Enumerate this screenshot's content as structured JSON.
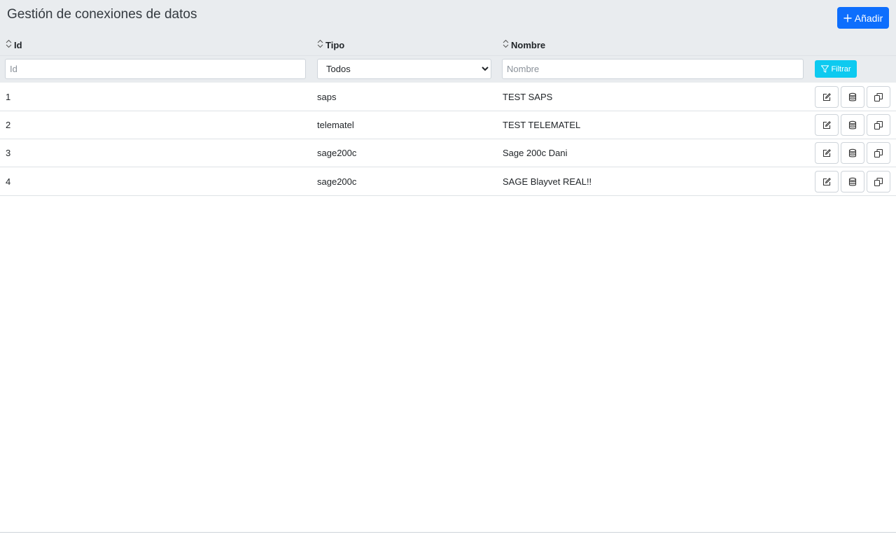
{
  "header": {
    "title": "Gestión de conexiones de datos",
    "add_label": "Añadir"
  },
  "columns": {
    "id": "Id",
    "tipo": "Tipo",
    "nombre": "Nombre"
  },
  "filters": {
    "id_placeholder": "Id",
    "tipo_selected": "Todos",
    "nombre_placeholder": "Nombre",
    "filter_label": "Filtrar"
  },
  "rows": [
    {
      "id": "1",
      "tipo": "saps",
      "nombre": "TEST SAPS"
    },
    {
      "id": "2",
      "tipo": "telematel",
      "nombre": "TEST TELEMATEL"
    },
    {
      "id": "3",
      "tipo": "sage200c",
      "nombre": "Sage 200c Dani"
    },
    {
      "id": "4",
      "tipo": "sage200c",
      "nombre": "SAGE Blayvet REAL!!"
    }
  ],
  "row_actions": [
    "edit-icon",
    "database-icon",
    "copy-icon"
  ],
  "colors": {
    "primary": "#0d6efd",
    "info": "#0dcaf0",
    "header_bg": "#e9ecef"
  }
}
